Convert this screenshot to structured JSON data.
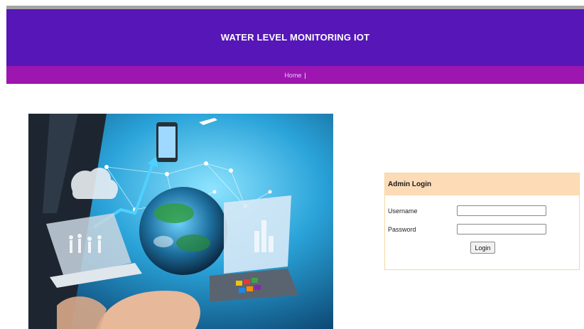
{
  "header": {
    "title": "WATER LEVEL MONITORING IOT"
  },
  "nav": {
    "items": [
      {
        "label": "Home"
      }
    ],
    "separator": "|"
  },
  "login": {
    "heading": "Admin Login",
    "username_label": "Username",
    "username_value": "",
    "password_label": "Password",
    "password_value": "",
    "button_label": "Login"
  },
  "colors": {
    "header_bg": "#5616b8",
    "nav_bg": "#9d16b0",
    "login_head_bg": "#fddbb6",
    "login_border": "#f3d9a4"
  }
}
